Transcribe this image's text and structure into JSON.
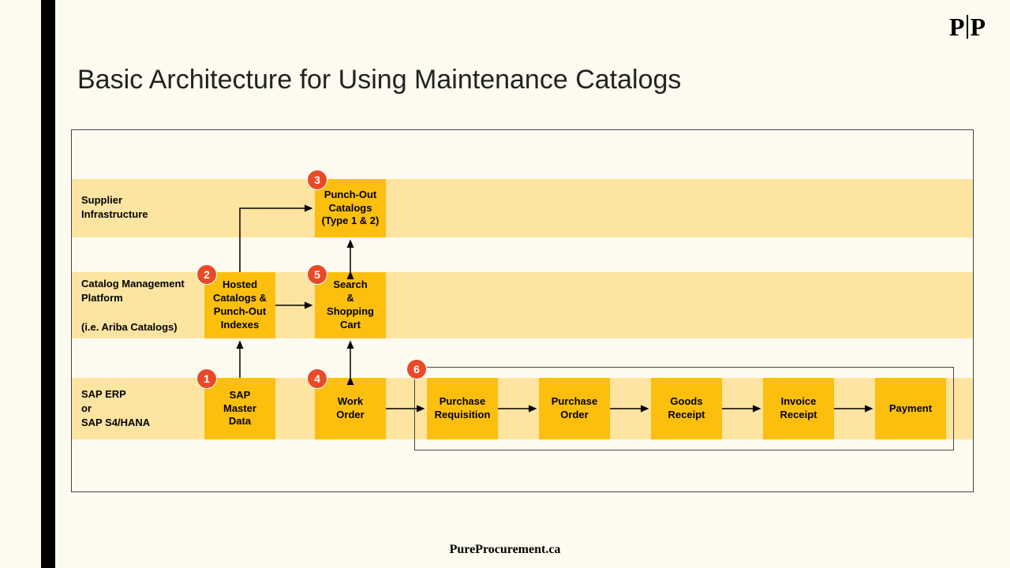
{
  "logo": {
    "left": "P",
    "right": "P"
  },
  "title": "Basic Architecture for Using Maintenance Catalogs",
  "bands": {
    "supplier": "Supplier\nInfrastructure",
    "catalog": "Catalog Management\nPlatform\n\n(i.e. Ariba Catalogs)",
    "sap": "SAP ERP\nor\nSAP S4/HANA"
  },
  "nodes": {
    "punchout": "Punch-Out\nCatalogs\n(Type 1 & 2)",
    "hosted": "Hosted\nCatalogs &\nPunch-Out\nIndexes",
    "search": "Search\n&\nShopping\nCart",
    "master": "SAP\nMaster\nData",
    "work": "Work\nOrder",
    "purreq": "Purchase\nRequisition",
    "purord": "Purchase\nOrder",
    "goods": "Goods\nReceipt",
    "invoice": "Invoice\nReceipt",
    "payment": "Payment"
  },
  "badges": {
    "b1": "1",
    "b2": "2",
    "b3": "3",
    "b4": "4",
    "b5": "5",
    "b6": "6"
  },
  "footer": "PureProcurement.ca"
}
